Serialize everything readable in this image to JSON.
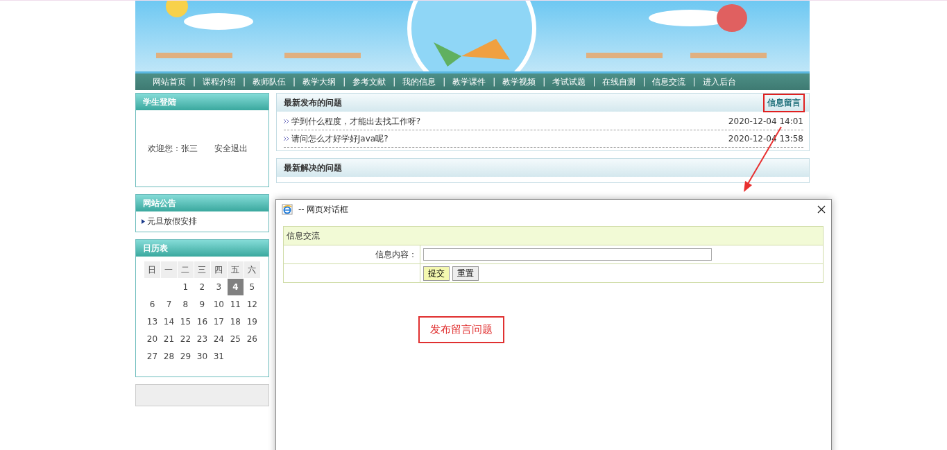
{
  "nav": [
    {
      "label": "网站首页"
    },
    {
      "label": "课程介绍"
    },
    {
      "label": "教师队伍"
    },
    {
      "label": "教学大纲"
    },
    {
      "label": "参考文献"
    },
    {
      "label": "我的信息"
    },
    {
      "label": "教学课件"
    },
    {
      "label": "教学视频"
    },
    {
      "label": "考试试题"
    },
    {
      "label": "在线自测"
    },
    {
      "label": "信息交流"
    },
    {
      "label": "进入后台"
    }
  ],
  "nav_separator": "|",
  "login": {
    "title": "学生登陆",
    "welcome": "欢迎您：张三",
    "logout": "安全退出"
  },
  "notice": {
    "title": "网站公告",
    "items": [
      "元旦放假安排"
    ]
  },
  "calendar": {
    "title": "日历表",
    "weekdays": [
      "日",
      "一",
      "二",
      "三",
      "四",
      "五",
      "六"
    ],
    "weeks": [
      [
        {
          "day": "1",
          "selected": false
        },
        {
          "day": "2",
          "selected": false
        },
        {
          "day": "3",
          "selected": false
        },
        {
          "day": "4",
          "selected": true
        },
        {
          "day": "5",
          "selected": false
        }
      ],
      [
        {
          "day": "6",
          "selected": false
        },
        {
          "day": "7",
          "selected": false
        },
        {
          "day": "8",
          "selected": false
        },
        {
          "day": "9",
          "selected": false
        },
        {
          "day": "10",
          "selected": false
        },
        {
          "day": "11",
          "selected": false
        },
        {
          "day": "12",
          "selected": false
        }
      ],
      [
        {
          "day": "13",
          "selected": false
        },
        {
          "day": "14",
          "selected": false
        },
        {
          "day": "15",
          "selected": false
        },
        {
          "day": "16",
          "selected": false
        },
        {
          "day": "17",
          "selected": false
        },
        {
          "day": "18",
          "selected": false
        },
        {
          "day": "19",
          "selected": false
        }
      ],
      [
        {
          "day": "20",
          "selected": false
        },
        {
          "day": "21",
          "selected": false
        },
        {
          "day": "22",
          "selected": false
        },
        {
          "day": "23",
          "selected": false
        },
        {
          "day": "24",
          "selected": false
        },
        {
          "day": "25",
          "selected": false
        },
        {
          "day": "26",
          "selected": false
        }
      ],
      [
        {
          "day": "27",
          "selected": false
        },
        {
          "day": "28",
          "selected": false
        },
        {
          "day": "29",
          "selected": false
        },
        {
          "day": "30",
          "selected": false
        },
        {
          "day": "31",
          "selected": false
        }
      ]
    ]
  },
  "latest": {
    "title": "最新发布的问题",
    "action": {
      "label": "信息留言",
      "highlighted": true
    },
    "items": [
      {
        "text": "学到什么程度，才能出去找工作呀?",
        "time": "2020-12-04 14:01"
      },
      {
        "text": "请问怎么才好学好Java呢?",
        "time": "2020-12-04 13:58"
      }
    ]
  },
  "solved": {
    "title": "最新解决的问题"
  },
  "dialog": {
    "title": "-- 网页对话框",
    "form_title": "信息交流",
    "field_label": "信息内容：",
    "buttons": [
      {
        "label": "提交",
        "kind": "primary"
      },
      {
        "label": "重置",
        "kind": "plain"
      }
    ],
    "annotation": "发布留言问题"
  }
}
